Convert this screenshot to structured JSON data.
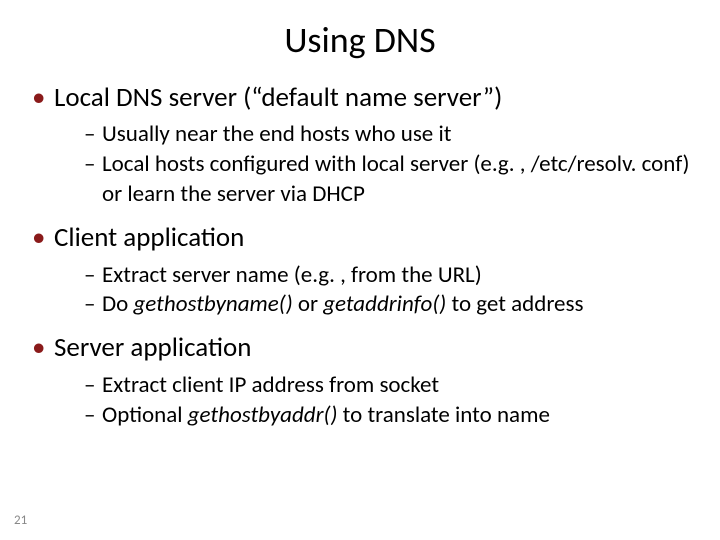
{
  "title": "Using DNS",
  "page_number": "21",
  "bullets": [
    {
      "text": "Local DNS server (“default name server”)",
      "sub": [
        {
          "text": "Usually near the end hosts who use it"
        },
        {
          "text": "Local hosts configured with local server (e.g. , /etc/resolv. conf) or learn the server via DHCP"
        }
      ]
    },
    {
      "text": "Client application",
      "sub": [
        {
          "text": "Extract server name (e.g. , from the URL)"
        },
        {
          "pre": "Do ",
          "em1": "gethostbyname()",
          "mid": " or ",
          "em2": "getaddrinfo()",
          "post": " to get address"
        }
      ]
    },
    {
      "text": "Server application",
      "sub": [
        {
          "text": "Extract client IP address from socket"
        },
        {
          "pre": "Optional ",
          "em1": "gethostbyaddr()",
          "post": " to translate into name"
        }
      ]
    }
  ]
}
